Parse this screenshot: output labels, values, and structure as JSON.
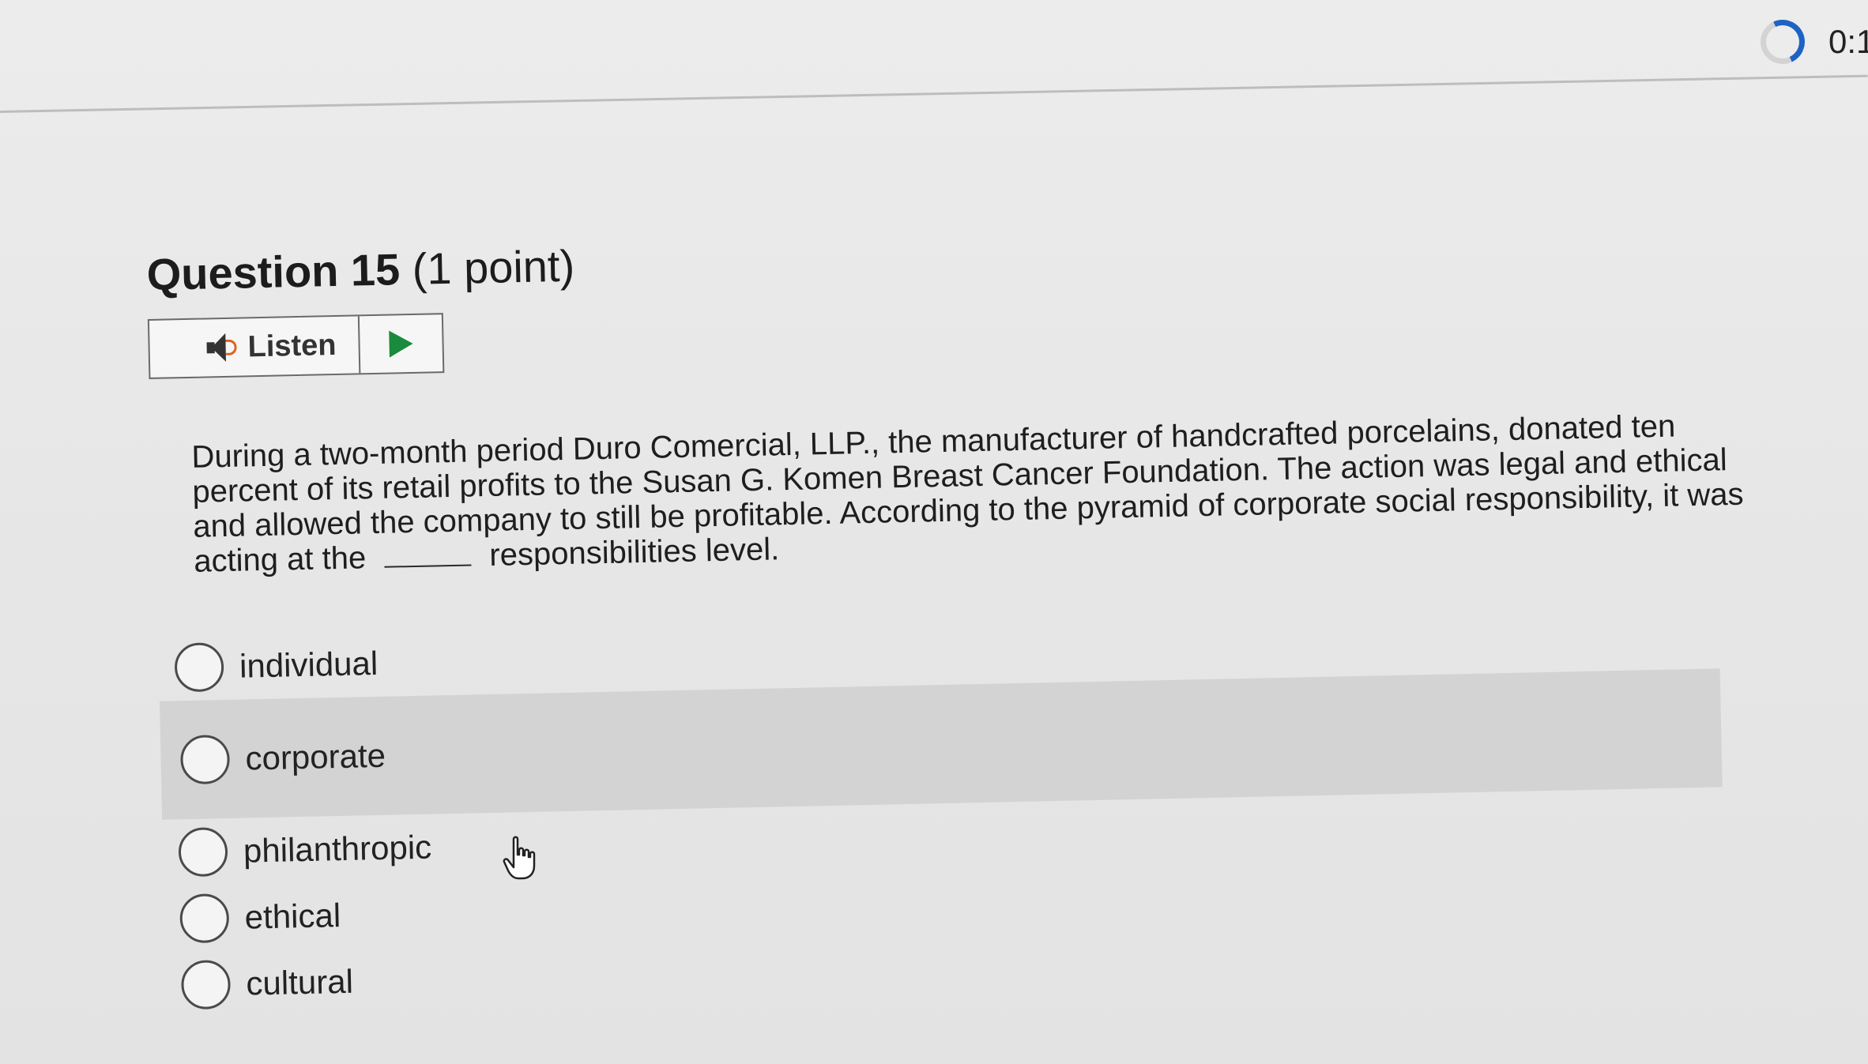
{
  "timer": {
    "text": "0:1"
  },
  "question": {
    "title_bold": "Question 15",
    "title_points": "(1 point)",
    "listen_label": "Listen",
    "text_before_blank": "During a two-month period Duro Comercial, LLP., the manufacturer of handcrafted porcelains, donated ten percent of its retail profits to the Susan G. Komen Breast Cancer Foundation.  The action was legal and ethical and allowed the company to still be profitable.  According to the pyramid of corporate social responsibility, it was acting at the",
    "text_after_blank": "responsibilities level."
  },
  "options": [
    {
      "label": "individual",
      "selected": false,
      "hovered": false
    },
    {
      "label": "corporate",
      "selected": false,
      "hovered": true
    },
    {
      "label": "philanthropic",
      "selected": false,
      "hovered": false
    },
    {
      "label": "ethical",
      "selected": false,
      "hovered": false
    },
    {
      "label": "cultural",
      "selected": false,
      "hovered": false
    }
  ],
  "icons": {
    "speaker": "speaker-icon",
    "play": "play-icon",
    "timer": "timer-progress-icon",
    "cursor": "hand-pointer-icon"
  },
  "colors": {
    "play": "#1a8a3c",
    "speaker_wave": "#e0601a",
    "timer_ring": "#1d63c4",
    "hover_row": "#d3d3d3"
  }
}
